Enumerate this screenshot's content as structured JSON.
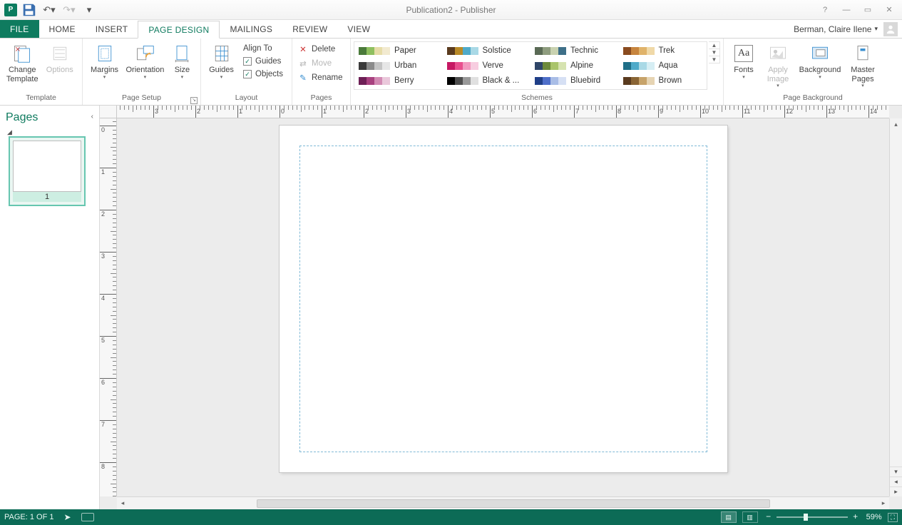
{
  "app": {
    "title": "Publication2 - Publisher"
  },
  "qat": {
    "save": "Save",
    "undo": "Undo",
    "redo": "Redo"
  },
  "window": {
    "help": "?",
    "minimize": "—",
    "restore": "▭",
    "close": "✕"
  },
  "user": {
    "name": "Berman, Claire Ilene"
  },
  "tabs": {
    "file": "FILE",
    "home": "HOME",
    "insert": "INSERT",
    "page_design": "PAGE DESIGN",
    "mailings": "MAILINGS",
    "review": "REVIEW",
    "view": "VIEW"
  },
  "ribbon": {
    "template": {
      "label": "Template",
      "change": "Change\nTemplate",
      "options": "Options"
    },
    "page_setup": {
      "label": "Page Setup",
      "margins": "Margins",
      "orientation": "Orientation",
      "size": "Size"
    },
    "layout": {
      "label": "Layout",
      "guides": "Guides",
      "align_to": "Align To",
      "chk_guides": "Guides",
      "chk_objects": "Objects"
    },
    "pages": {
      "label": "Pages",
      "delete": "Delete",
      "move": "Move",
      "rename": "Rename"
    },
    "schemes": {
      "label": "Schemes",
      "items": [
        {
          "name": "Paper",
          "c": [
            "#4a7a3a",
            "#8fbf5f",
            "#e6dca8",
            "#f2ead0"
          ]
        },
        {
          "name": "Solstice",
          "c": [
            "#5a3b1f",
            "#b98a27",
            "#4faac9",
            "#a9d9e6"
          ]
        },
        {
          "name": "Technic",
          "c": [
            "#5a6a55",
            "#8f9d7f",
            "#c9d2b0",
            "#3e6f88"
          ]
        },
        {
          "name": "Trek",
          "c": [
            "#8a4b1f",
            "#c7853e",
            "#e0b36a",
            "#f0d9a8"
          ]
        },
        {
          "name": "Urban",
          "c": [
            "#3a3a3a",
            "#8a8a8a",
            "#c4c4c4",
            "#e6e6e6"
          ]
        },
        {
          "name": "Verve",
          "c": [
            "#c61863",
            "#e84f8e",
            "#f29ac0",
            "#f7cde0"
          ]
        },
        {
          "name": "Alpine",
          "c": [
            "#2f4668",
            "#6d8a3a",
            "#a9c46a",
            "#d6e3b0"
          ]
        },
        {
          "name": "Aqua",
          "c": [
            "#1f6f88",
            "#4faac9",
            "#a9d9e6",
            "#d6eef4"
          ]
        },
        {
          "name": "Berry",
          "c": [
            "#6d1f55",
            "#a8417f",
            "#d28ab3",
            "#eac8db"
          ]
        },
        {
          "name": "Black & ...",
          "c": [
            "#000000",
            "#4d4d4d",
            "#999999",
            "#e0e0e0"
          ]
        },
        {
          "name": "Bluebird",
          "c": [
            "#1f3f88",
            "#4f6fc9",
            "#a9bde6",
            "#d6e0f4"
          ]
        },
        {
          "name": "Brown",
          "c": [
            "#5a3b1f",
            "#8a6535",
            "#c7a36a",
            "#e6d4b3"
          ]
        }
      ]
    },
    "page_bg": {
      "label": "Page Background",
      "fonts": "Fonts",
      "apply_image": "Apply\nImage",
      "background": "Background",
      "master": "Master\nPages"
    }
  },
  "pages_panel": {
    "title": "Pages",
    "thumb_num": "1"
  },
  "status": {
    "page": "PAGE: 1 OF 1",
    "zoom": "59%"
  }
}
